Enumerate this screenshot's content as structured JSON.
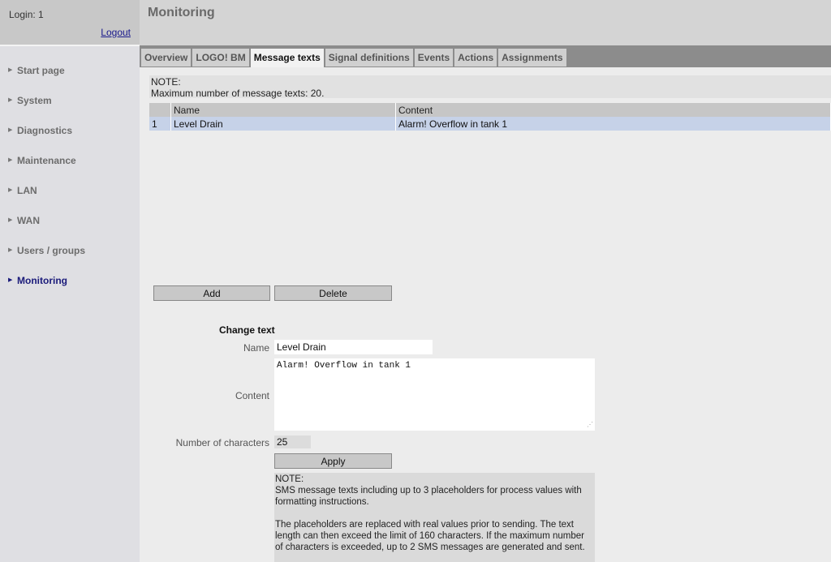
{
  "sidebar": {
    "login": "Login: 1",
    "logout": "Logout",
    "items": [
      {
        "label": "Start page"
      },
      {
        "label": "System"
      },
      {
        "label": "Diagnostics"
      },
      {
        "label": "Maintenance"
      },
      {
        "label": "LAN"
      },
      {
        "label": "WAN"
      },
      {
        "label": "Users / groups"
      },
      {
        "label": "Monitoring"
      }
    ]
  },
  "header": {
    "title": "Monitoring"
  },
  "tabs": [
    {
      "label": "Overview"
    },
    {
      "label": "LOGO! BM"
    },
    {
      "label": "Message texts"
    },
    {
      "label": "Signal definitions"
    },
    {
      "label": "Events"
    },
    {
      "label": "Actions"
    },
    {
      "label": "Assignments"
    }
  ],
  "note_top": {
    "title": "NOTE:",
    "text": "Maximum number of message texts: 20."
  },
  "table": {
    "columns": [
      "",
      "Name",
      "Content"
    ],
    "rows": [
      {
        "index": "1",
        "name": "Level Drain",
        "content": "Alarm! Overflow in tank 1"
      }
    ]
  },
  "buttons": {
    "add": "Add",
    "delete": "Delete",
    "apply": "Apply"
  },
  "form": {
    "title": "Change text",
    "name_label": "Name",
    "name_value": "Level Drain",
    "content_label": "Content",
    "content_value": "Alarm! Overflow in tank 1",
    "count_label": "Number of characters",
    "count_value": "25"
  },
  "note_bottom": {
    "title": "NOTE:",
    "para1": "SMS message texts including up to 3 placeholders for process values with formatting instructions.",
    "para2": "The placeholders are replaced with real values prior to sending. The text length can then exceed the limit of 160 characters. If the maximum number of characters is exceeded, up to 2 SMS messages are generated and sent."
  }
}
